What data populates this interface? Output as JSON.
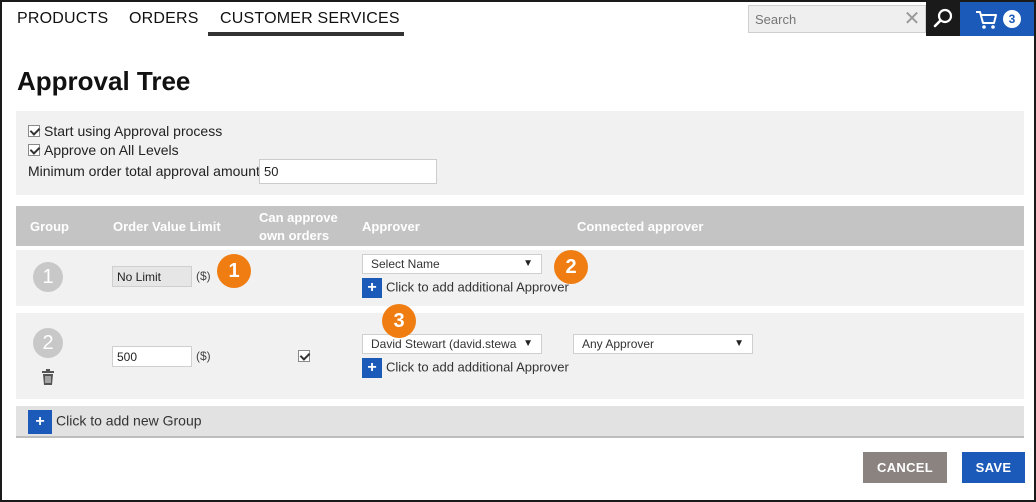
{
  "nav": {
    "items": [
      "PRODUCTS",
      "ORDERS",
      "CUSTOMER SERVICES"
    ],
    "active_index": 2,
    "search_placeholder": "Search",
    "search_clear": "✕",
    "cart_count": "3"
  },
  "page": {
    "title": "Approval Tree"
  },
  "settings": {
    "start_approval_label": "Start using Approval process",
    "start_approval_checked": true,
    "all_levels_label": "Approve on All Levels",
    "all_levels_checked": true,
    "min_amount_label": "Minimum order total approval amount:",
    "min_amount_value": "50"
  },
  "table": {
    "headers": {
      "group": "Group",
      "order_value_limit": "Order Value Limit",
      "can_approve_line1": "Can approve",
      "can_approve_line2": "own orders",
      "approver": "Approver",
      "connected_approver": "Connected approver"
    },
    "groups": [
      {
        "number": "1",
        "limit_value": "No Limit",
        "currency": "($)",
        "can_approve_own": false,
        "approver": "Select Name",
        "add_approver_label": "Click to add additional Approver"
      },
      {
        "number": "2",
        "limit_value": "500",
        "currency": "($)",
        "can_approve_own": true,
        "approver": "David Stewart (david.stewa",
        "connected_approver": "Any Approver",
        "add_approver_label": "Click to add additional Approver"
      }
    ],
    "add_group_label": "Click to add new Group"
  },
  "callouts": [
    "1",
    "2",
    "3"
  ],
  "actions": {
    "cancel": "CANCEL",
    "save": "SAVE"
  },
  "colors": {
    "accent": "#1b5ab8",
    "callout": "#f07d12",
    "cancel": "#8a8380",
    "header": "#c4c4c4"
  },
  "icons": [
    "search-icon",
    "cart-icon",
    "close-icon",
    "trash-icon",
    "plus-icon",
    "chevron-down-icon",
    "checkbox-icon"
  ]
}
